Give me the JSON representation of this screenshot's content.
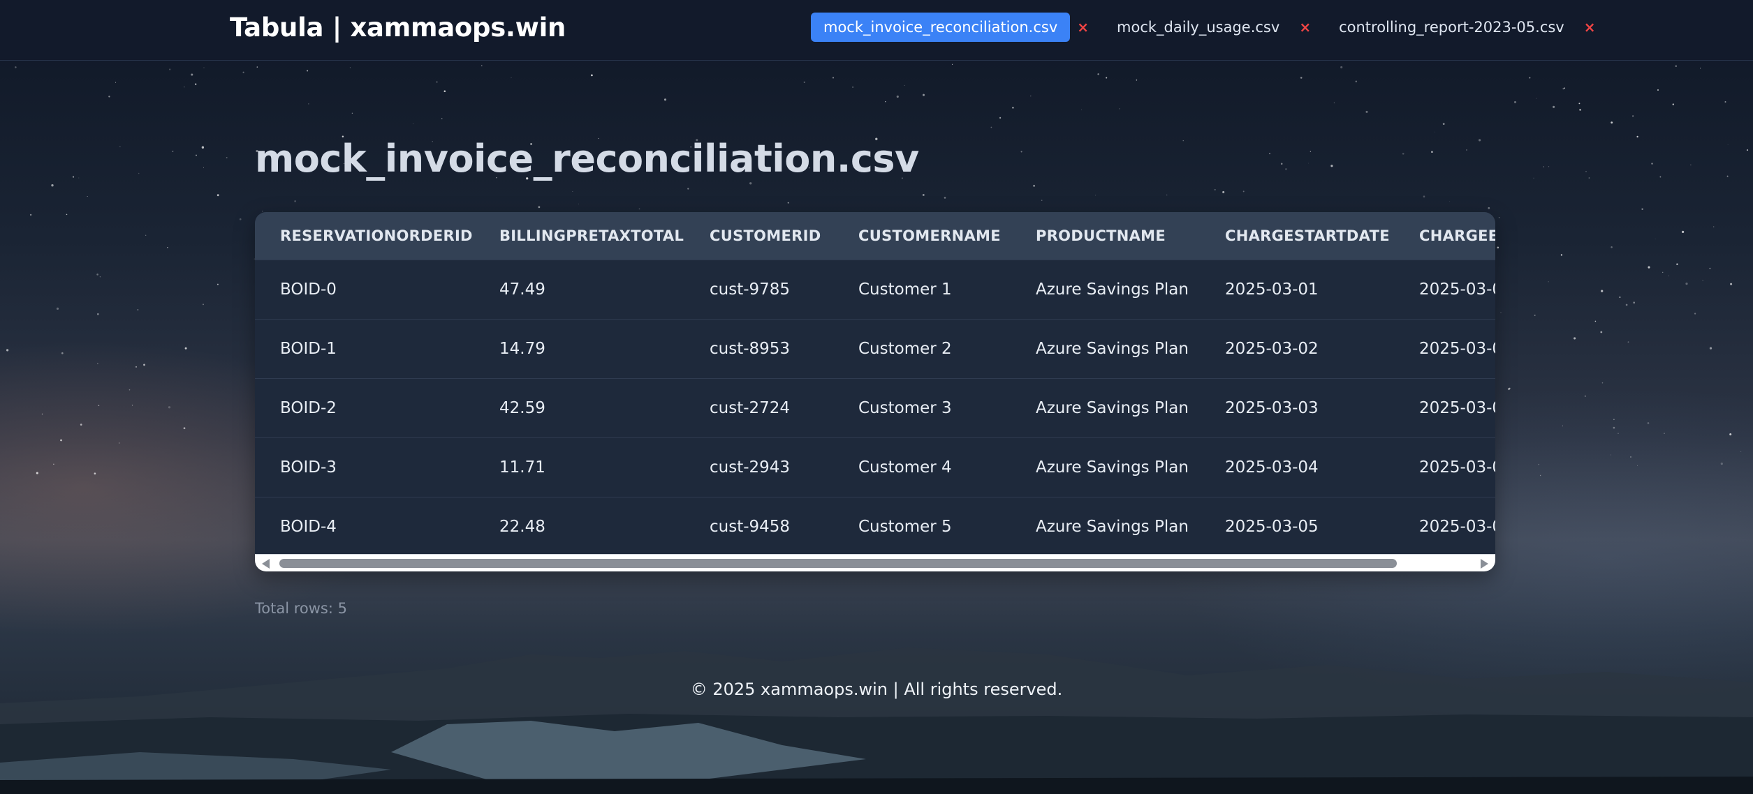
{
  "header": {
    "brand": "Tabula | xammaops.win",
    "tabs": [
      {
        "label": "mock_invoice_reconciliation.csv",
        "active": true
      },
      {
        "label": "mock_daily_usage.csv",
        "active": false
      },
      {
        "label": "controlling_report-2023-05.csv",
        "active": false
      }
    ],
    "close_glyph": "×"
  },
  "main": {
    "title": "mock_invoice_reconciliation.csv",
    "table": {
      "columns": [
        "RESERVATIONORDERID",
        "BILLINGPRETAXTOTAL",
        "CUSTOMERID",
        "CUSTOMERNAME",
        "PRODUCTNAME",
        "CHARGESTARTDATE",
        "CHARGEEN"
      ],
      "rows": [
        [
          "BOID-0",
          "47.49",
          "cust-9785",
          "Customer 1",
          "Azure Savings Plan",
          "2025-03-01",
          "2025-03-0"
        ],
        [
          "BOID-1",
          "14.79",
          "cust-8953",
          "Customer 2",
          "Azure Savings Plan",
          "2025-03-02",
          "2025-03-0"
        ],
        [
          "BOID-2",
          "42.59",
          "cust-2724",
          "Customer 3",
          "Azure Savings Plan",
          "2025-03-03",
          "2025-03-0"
        ],
        [
          "BOID-3",
          "11.71",
          "cust-2943",
          "Customer 4",
          "Azure Savings Plan",
          "2025-03-04",
          "2025-03-0"
        ],
        [
          "BOID-4",
          "22.48",
          "cust-9458",
          "Customer 5",
          "Azure Savings Plan",
          "2025-03-05",
          "2025-03-0"
        ]
      ]
    },
    "total_rows": "Total rows: 5"
  },
  "footer": {
    "text": "© 2025 xammaops.win | All rights reserved."
  },
  "colors": {
    "active_tab": "#3b82f6",
    "close_icon": "#ef4444",
    "header_bg": "#121a2b",
    "table_header_bg": "#334155",
    "table_row_bg": "#1e293b"
  },
  "icons": [
    "close-icon",
    "scroll-left-arrow-icon",
    "scroll-right-arrow-icon"
  ]
}
